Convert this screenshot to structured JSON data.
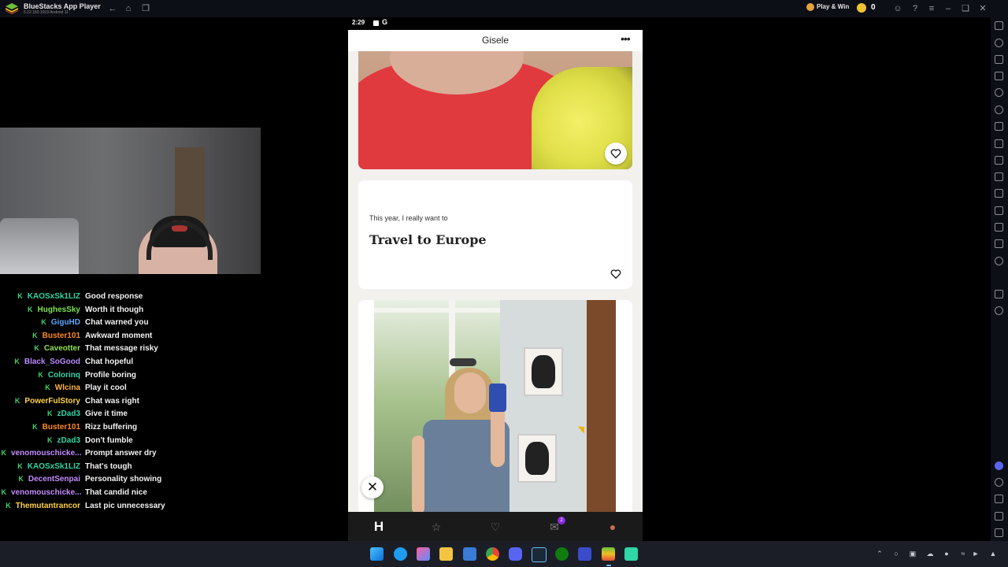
{
  "bluestacks": {
    "title": "BlueStacks App Player",
    "version": "5.22.150.1019  Android 11",
    "play_win_label": "Play & Win",
    "coin_count": "0"
  },
  "phone": {
    "status_time": "2:29",
    "status_letter": "G",
    "profile_name": "Gisele",
    "more_icon": "•••",
    "prompt": {
      "question": "This year, I really want to",
      "answer": "Travel to Europe"
    },
    "close_icon": "✕",
    "nav": {
      "home": "H",
      "standouts": "☆",
      "likes": "♡",
      "messages": "✉",
      "profile": "●",
      "messages_badge": "2"
    }
  },
  "chat": [
    {
      "user": "KAOSxSk1LIZ",
      "message": "Good response",
      "color": "#2fd6a6"
    },
    {
      "user": "HughesSky",
      "message": "Worth it though",
      "color": "#7de34f"
    },
    {
      "user": "GiguHD",
      "message": "Chat warned you",
      "color": "#5aa7ff"
    },
    {
      "user": "Buster101",
      "message": "Awkward moment",
      "color": "#ff8a1f"
    },
    {
      "user": "Caveotter",
      "message": "That message risky",
      "color": "#8fe34f"
    },
    {
      "user": "Black_SoGood",
      "message": "Chat hopeful",
      "color": "#b98bff"
    },
    {
      "user": "Colorinq",
      "message": "Profile boring",
      "color": "#2fd6a6"
    },
    {
      "user": "Wlcina",
      "message": "Play it cool",
      "color": "#ffb347"
    },
    {
      "user": "PowerFulStory",
      "message": "Chat was right",
      "color": "#ffd23f"
    },
    {
      "user": "zDad3",
      "message": "Give it time",
      "color": "#2fd6a6"
    },
    {
      "user": "Buster101",
      "message": "Rizz buffering",
      "color": "#ff8a1f"
    },
    {
      "user": "zDad3",
      "message": "Don't fumble",
      "color": "#2fd6a6"
    },
    {
      "user": "venomouschicke...",
      "message": "Prompt answer dry",
      "color": "#c48bff"
    },
    {
      "user": "KAOSxSk1LIZ",
      "message": "That's tough",
      "color": "#2fd6a6"
    },
    {
      "user": "DecentSenpai",
      "message": "Personality showing",
      "color": "#c48bff"
    },
    {
      "user": "venomouschicke...",
      "message": "That candid nice",
      "color": "#c48bff"
    },
    {
      "user": "Themutantrancor",
      "message": "Last pic unnecessary",
      "color": "#ffd23f"
    }
  ],
  "icons": {
    "titlebar": [
      "back-icon",
      "home-icon",
      "tabs-icon"
    ],
    "window": [
      "account-icon",
      "help-icon",
      "menu-icon",
      "minimize-icon",
      "maximize-icon",
      "close-icon"
    ]
  },
  "colors": {
    "chat_badge": "#3fd46a",
    "nav_active": "#ffffff",
    "nav_inactive": "#7b7b7b",
    "badge": "#8a2be2"
  }
}
